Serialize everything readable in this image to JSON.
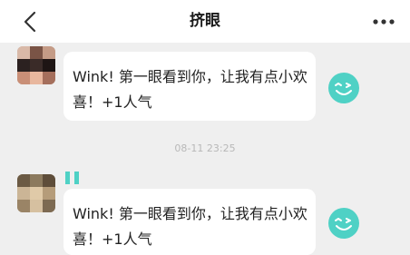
{
  "header": {
    "title": "挤眼"
  },
  "messages": [
    {
      "sender_name": "",
      "text": "Wink! 第一眼看到你，让我有点小欢喜！+1人气"
    },
    {
      "sender_name": "",
      "text": "Wink! 第一眼看到你，让我有点小欢喜！+1人气"
    }
  ],
  "timestamp": "08-11 23:25",
  "colors": {
    "accent": "#4fd1c5",
    "name": "#26c6da",
    "background": "#efefef"
  },
  "icons": {
    "back": "chevron-left-icon",
    "more": "more-dots-icon",
    "wink": "wink-face-icon"
  }
}
